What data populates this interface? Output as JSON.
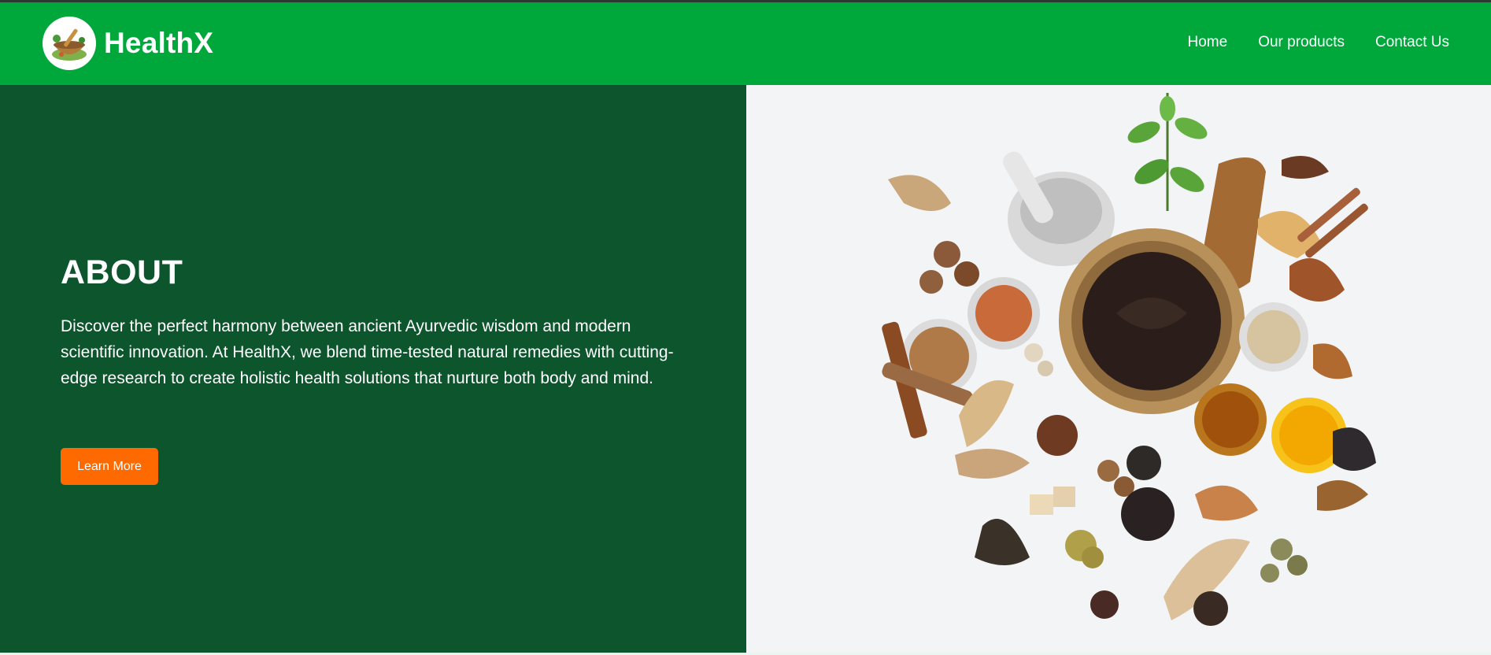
{
  "brand": {
    "name": "HealthX"
  },
  "nav": {
    "items": [
      "Home",
      "Our products",
      "Contact Us"
    ]
  },
  "about": {
    "title": "ABOUT",
    "text": "Discover the perfect harmony between ancient Ayurvedic wisdom and modern scientific innovation. At HealthX, we blend time-tested natural remedies with cutting-edge research to create holistic health solutions that nurture both body and mind.",
    "button_label": "Learn More"
  },
  "colors": {
    "navbar": "#00a83c",
    "panel": "#0d552d",
    "button": "#ff6a00",
    "image_bg": "#f3f4f6"
  }
}
